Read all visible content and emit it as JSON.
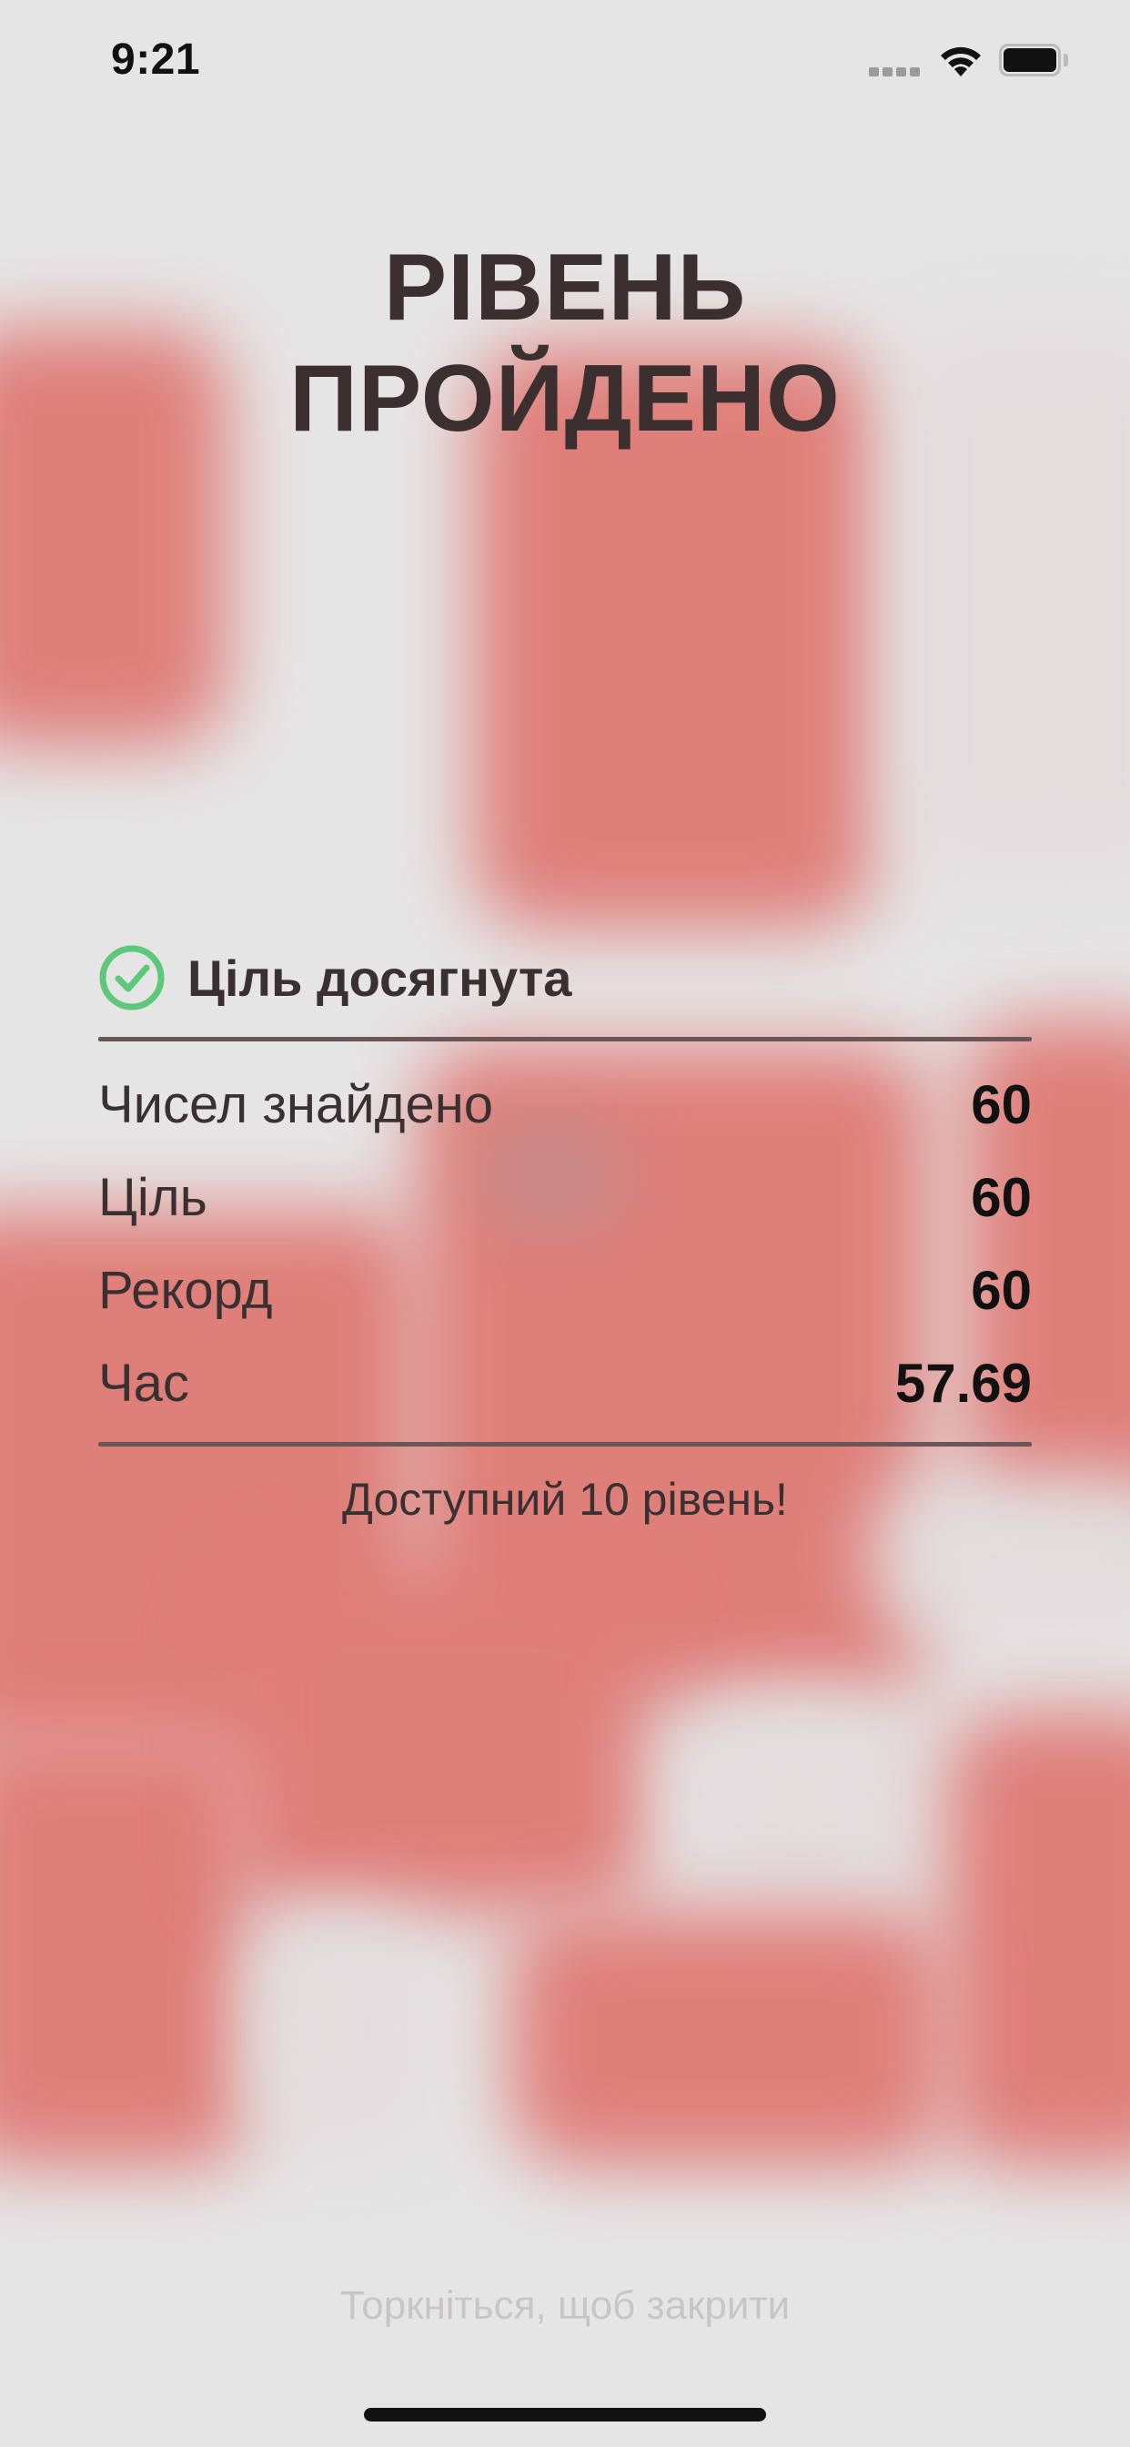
{
  "status_bar": {
    "time": "9:21"
  },
  "title": {
    "line1": "Рівень",
    "line2": "пройдено"
  },
  "goal": {
    "label": "Ціль досягнута",
    "icon": "check-circle-icon",
    "icon_color": "#5dc77a"
  },
  "stats": [
    {
      "label": "Чисел знайдено",
      "value": "60"
    },
    {
      "label": "Ціль",
      "value": "60"
    },
    {
      "label": "Рекорд",
      "value": "60"
    },
    {
      "label": "Час",
      "value": "57.69"
    }
  ],
  "unlock_message": "Доступний 10 рівень!",
  "tap_hint": "Торкніться, щоб закрити",
  "colors": {
    "background": "#e6e5e6",
    "board_red": "#df7f7a",
    "text_dark": "#3a2f31"
  }
}
